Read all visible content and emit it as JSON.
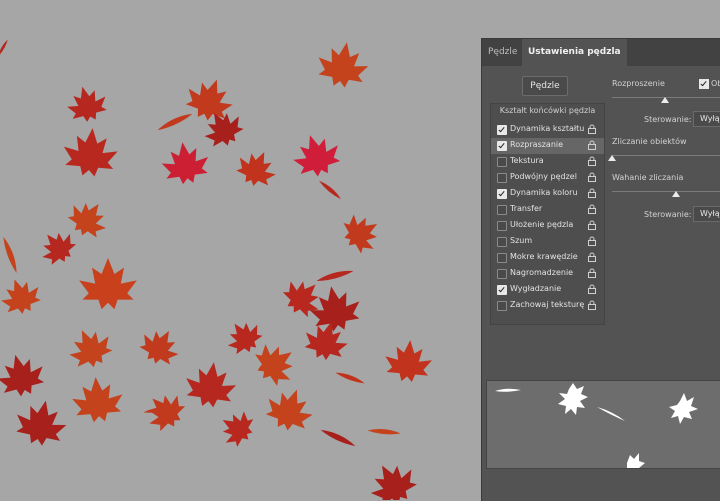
{
  "tabs": [
    {
      "label": "Pędzle",
      "active": false
    },
    {
      "label": "Ustawienia pędzla",
      "active": true
    }
  ],
  "brushes_button": "Pędzle",
  "brush_tip_header": "Kształt końcówki pędzla",
  "options": [
    {
      "label": "Dynamika kształtu",
      "checked": true,
      "selected": false
    },
    {
      "label": "Rozpraszanie",
      "checked": true,
      "selected": true
    },
    {
      "label": "Tekstura",
      "checked": false,
      "selected": false
    },
    {
      "label": "Podwójny pędzel",
      "checked": false,
      "selected": false
    },
    {
      "label": "Dynamika koloru",
      "checked": true,
      "selected": false
    },
    {
      "label": "Transfer",
      "checked": false,
      "selected": false
    },
    {
      "label": "Ułożenie pędzla",
      "checked": false,
      "selected": false
    },
    {
      "label": "Szum",
      "checked": false,
      "selected": false
    },
    {
      "label": "Mokre krawędzie",
      "checked": false,
      "selected": false
    },
    {
      "label": "Nagromadzenie",
      "checked": false,
      "selected": false
    },
    {
      "label": "Wygładzanie",
      "checked": true,
      "selected": false
    },
    {
      "label": "Zachowaj teksturę",
      "checked": false,
      "selected": false
    }
  ],
  "scatter": {
    "label": "Rozproszenie",
    "both_axes_label": "Ob",
    "both_axes_checked": true,
    "control_label": "Sterowanie:",
    "control_value": "Wyłą"
  },
  "count": {
    "label": "Zliczanie obiektów"
  },
  "count_jitter": {
    "label": "Wahanie zliczania",
    "control_label": "Sterowanie:",
    "control_value": "Wyłą"
  },
  "colors": {
    "panel": "#535353",
    "canvas": "#a6a6a6",
    "leaf_red": "#b5271f",
    "leaf_orange": "#c4421c"
  }
}
